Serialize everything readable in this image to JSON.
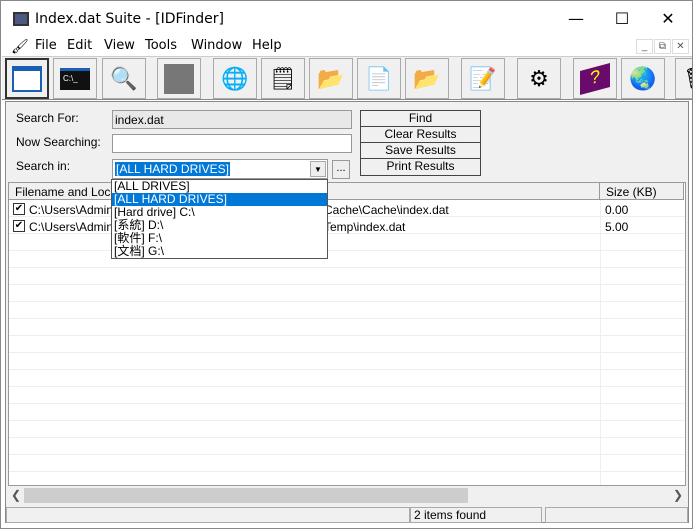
{
  "window": {
    "title": "Index.dat Suite - [IDFinder]"
  },
  "menu": [
    "File",
    "Edit",
    "View",
    "Tools",
    "Window",
    "Help"
  ],
  "toolbar": [
    "window-icon",
    "console-icon",
    "search-window-icon",
    "disabled-icon",
    "globe-icon",
    "notes-icon",
    "folder-globe-icon",
    "windows-file-icon",
    "open-folder-icon",
    "document-edit-icon",
    "settings-window-icon",
    "help-book-icon",
    "internet-icon",
    "trash-icon"
  ],
  "form": {
    "search_for_label": "Search For:",
    "search_for_value": "index.dat",
    "now_searching_label": "Now Searching:",
    "now_searching_value": "",
    "search_in_label": "Search in:",
    "search_in_value": "[ALL HARD DRIVES]",
    "browse_label": "..."
  },
  "buttons": {
    "find": "Find",
    "clear": "Clear Results",
    "save": "Save Results",
    "print": "Print Results"
  },
  "dropdown": [
    "[ALL DRIVES]",
    "[ALL HARD DRIVES]",
    "[Hard drive] C:\\",
    "[系統] D:\\",
    "[軟件] F:\\",
    "[文档] G:\\"
  ],
  "list": {
    "headers": [
      "Filename and Location",
      "Size (KB)"
    ],
    "rows": [
      {
        "checked": true,
        "path_start": "C:\\Users\\Adminis",
        "path_end": "Cache\\Cache\\index.dat",
        "size": "0.00"
      },
      {
        "checked": true,
        "path_start": "C:\\Users\\Adminis",
        "path_end": "Temp\\index.dat",
        "size": "5.00"
      }
    ]
  },
  "status": {
    "text": "2 items found"
  }
}
